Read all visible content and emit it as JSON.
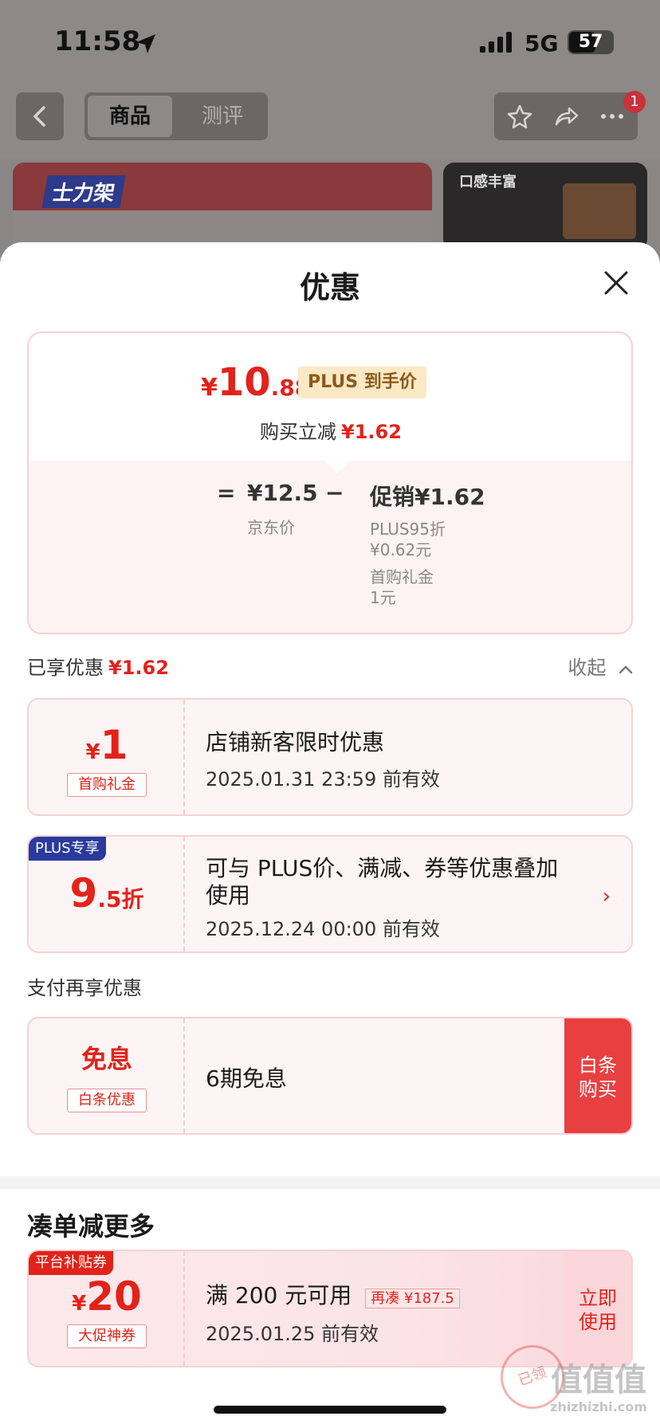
{
  "status_bar": {
    "time": "11:58",
    "network": "5G",
    "battery": "57",
    "battery_level": 0.57,
    "icons": [
      "location-arrow-icon",
      "signal-icon",
      "battery-icon"
    ]
  },
  "header": {
    "tabs": [
      {
        "label": "商品",
        "active": true
      },
      {
        "label": "测评",
        "active": false
      }
    ],
    "badge_count": "1",
    "icons": [
      "back-icon",
      "star-icon",
      "share-icon",
      "more-icon"
    ]
  },
  "background_product": {
    "brand": "士力架",
    "thumb_caption": "口感丰富"
  },
  "sheet": {
    "title": "优惠",
    "price": {
      "currency": "¥",
      "integer": "10",
      "decimal": ".88",
      "plus_tag": "PLUS 到手价",
      "instant_label": "购买立减",
      "instant_value": "¥1.62"
    },
    "formula": {
      "equals": "=",
      "base_value": "¥12.5",
      "base_label": "京东价",
      "minus": "−",
      "promo_label": "促销",
      "promo_value": "¥1.62",
      "details": [
        {
          "line1": "PLUS95折",
          "line2": "¥0.62元"
        },
        {
          "line1": "首购礼金",
          "line2": "1元"
        }
      ]
    },
    "enjoyed": {
      "label": "已享优惠",
      "value": "¥1.62",
      "collapse": "收起"
    },
    "coupons": [
      {
        "currency": "¥",
        "amount": "1",
        "tag": "首购礼金",
        "title": "店铺新客限时优惠",
        "desc": "2025.01.31 23:59 前有效"
      },
      {
        "corner": "PLUS专享",
        "amount_big": "9",
        "amount_small": ".5折",
        "title_line1": "可与 PLUS价、满减、券等优惠叠加",
        "title_line2": "使用",
        "desc": "2025.12.24 00:00 前有效"
      }
    ],
    "payment": {
      "label": "支付再享优惠",
      "amount": "免息",
      "tag": "白条优惠",
      "title": "6期免息",
      "button_line1": "白条",
      "button_line2": "购买"
    },
    "more": {
      "title": "凑单减更多",
      "corner": "平台补贴券",
      "currency": "¥",
      "amount": "20",
      "tag": "大促神券",
      "title_text": "满 200 元可用",
      "extra": "再凑 ¥187.5",
      "desc": "2025.01.25 前有效",
      "button_line1": "立即",
      "button_line2": "使用",
      "stamp": "已领"
    }
  },
  "watermark": {
    "text": "值值值",
    "site": "zhizhizhi.com"
  },
  "colors": {
    "accent_red": "#e2231a",
    "plus_blue": "#2a3a9c",
    "plus_gold_bg": "#fbe8c4"
  }
}
